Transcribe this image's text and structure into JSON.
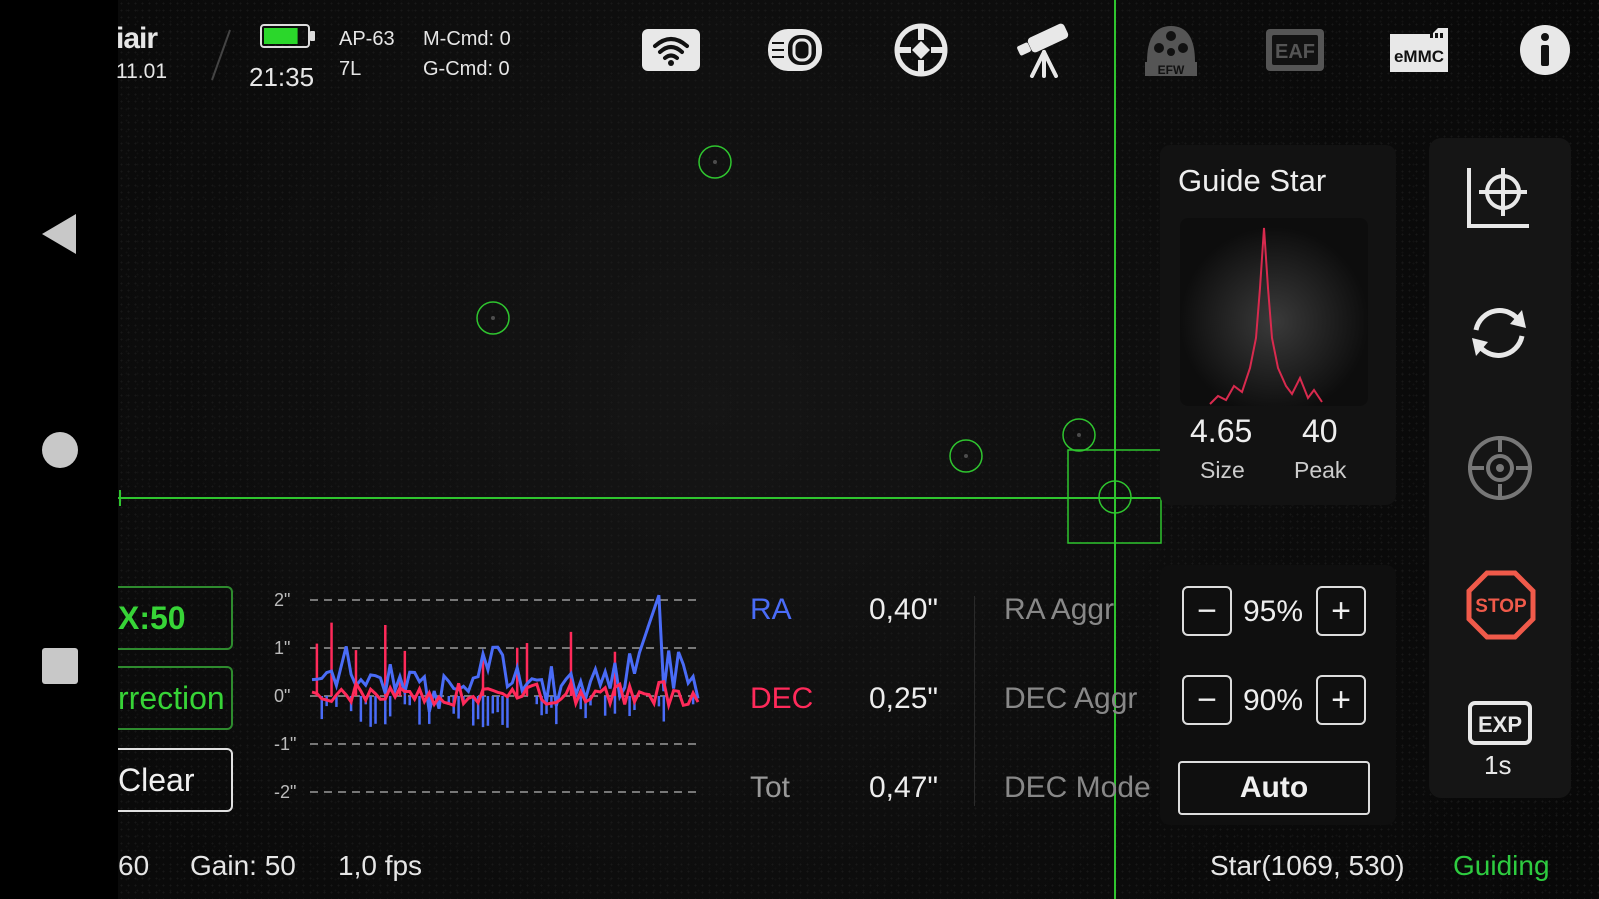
{
  "status": {
    "app_fragment": "iair",
    "version_fragment": "11.01",
    "time": "21:35",
    "device": "AP-63",
    "device_sub": "7L",
    "m_cmd": "M-Cmd: 0",
    "g_cmd": "G-Cmd: 0",
    "battery_level": 0.8
  },
  "toolbar": [
    {
      "icon": "wifi-icon"
    },
    {
      "icon": "camera-icon"
    },
    {
      "icon": "guide-target-icon"
    },
    {
      "icon": "telescope-icon"
    },
    {
      "icon": "efw-icon",
      "label": "EFW"
    },
    {
      "icon": "eaf-icon",
      "label": "EAF"
    },
    {
      "icon": "emmc-icon",
      "label": "eMMC"
    },
    {
      "icon": "info-icon"
    }
  ],
  "guide_star": {
    "title": "Guide Star",
    "size_value": "4.65",
    "size_label": "Size",
    "peak_value": "40",
    "peak_label": "Peak"
  },
  "left_buttons": {
    "x_scale": "X:50",
    "correction": "rrection",
    "clear": "Clear"
  },
  "graph": {
    "y_ticks": [
      "2\"",
      "1\"",
      "0\"",
      "-1\"",
      "-2\""
    ],
    "colors": {
      "ra": "#4a6cf7",
      "dec": "#ff2a5a"
    }
  },
  "stats": {
    "ra_label": "RA",
    "ra_value": "0,40\"",
    "dec_label": "DEC",
    "dec_value": "0,25\"",
    "tot_label": "Tot",
    "tot_value": "0,47\""
  },
  "aggr": {
    "ra_label": "RA Aggr",
    "ra_value": "95%",
    "dec_label": "DEC Aggr",
    "dec_value": "90%",
    "dec_mode_label": "DEC Mode",
    "dec_mode_value": "Auto",
    "minus": "−",
    "plus": "+"
  },
  "right_tools": {
    "stop_label": "STOP",
    "exp_label": "EXP",
    "exp_value": "1s"
  },
  "bottom": {
    "exposure_fragment": "60",
    "gain": "Gain: 50",
    "fps": "1,0 fps",
    "star_pos": "Star(1069, 530)",
    "state": "Guiding"
  }
}
